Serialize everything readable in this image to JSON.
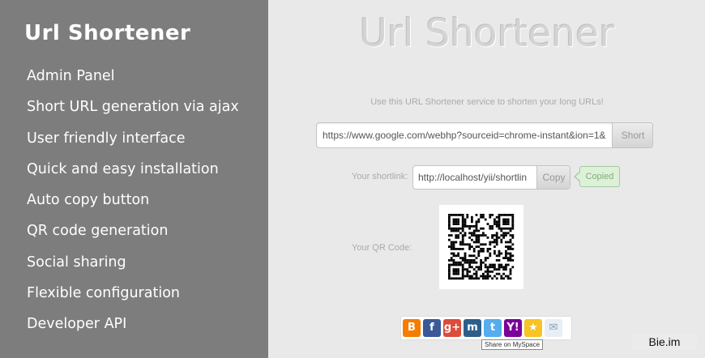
{
  "sidebar": {
    "title": "Url Shortener",
    "features": [
      "Admin Panel",
      "Short URL generation via ajax",
      "User friendly interface",
      "Quick and easy installation",
      "Auto copy button",
      "QR code generation",
      "Social sharing",
      "Flexible configuration",
      "Developer API"
    ]
  },
  "main": {
    "title": "Url Shortener",
    "intro": "Use this URL Shortener service to shorten your long URLs!",
    "long_url_value": "https://www.google.com/webhp?sourceid=chrome-instant&ion=1&",
    "short_button": "Short",
    "shortlink_label": "Your shortlink:",
    "shortlink_value": "http://localhost/yii/shortlin",
    "copy_button": "Copy",
    "copied_label": "Copied",
    "qr_label": "Your QR Code:",
    "social_icons": [
      {
        "name": "blogger-icon",
        "glyph": "B",
        "color": "#f57d00"
      },
      {
        "name": "facebook-icon",
        "glyph": "f",
        "color": "#3b5998"
      },
      {
        "name": "google-plus-icon",
        "glyph": "g+",
        "color": "#dd4b39"
      },
      {
        "name": "myspace-icon",
        "glyph": "m",
        "color": "#2d5e8a"
      },
      {
        "name": "twitter-icon",
        "glyph": "t",
        "color": "#55acee"
      },
      {
        "name": "yahoo-icon",
        "glyph": "Y!",
        "color": "#7b0099"
      },
      {
        "name": "favorite-star-icon",
        "glyph": "★",
        "color": "#f7c325"
      },
      {
        "name": "email-icon",
        "glyph": "✉",
        "color": "#e8eef5"
      }
    ],
    "tooltip": "Share on MySpace"
  },
  "watermark": "Bie.im"
}
